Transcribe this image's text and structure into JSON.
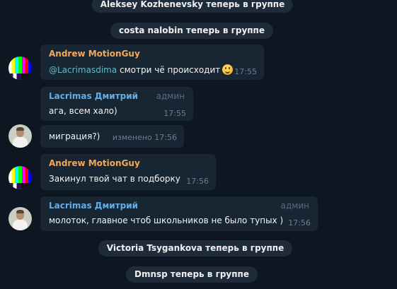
{
  "service_messages": {
    "aleksey": "Aleksey Kozhenevsky теперь в группе",
    "costa": "costa nalobin теперь в группе",
    "victoria": "Victoria Tsygankova теперь в группе",
    "dmnsp": "Dmnsp теперь в группе"
  },
  "messages": [
    {
      "sender": "Andrew MotionGuy",
      "mention": "@Lacrimasdima",
      "text": " смотри чё происходит",
      "emoji": "smiling-face",
      "time": "17:55"
    },
    {
      "sender": "Lacrimas Дмитрий",
      "role": "админ",
      "text": "ага, всем хало)",
      "time": "17:55"
    },
    {
      "text": "миграция?)",
      "time": "изменено 17:56"
    },
    {
      "sender": "Andrew MotionGuy",
      "text": "Закинул твой чат в подборку",
      "time": "17:56"
    },
    {
      "sender": "Lacrimas Дмитрий",
      "role": "админ",
      "text": "молоток, главное чтоб школьников не было тупых )",
      "time": "17:56"
    }
  ],
  "colors": {
    "background": "#0e1621",
    "bubble": "#182533",
    "service_pill": "#1e2c3a",
    "sender_andrew": "#f3a95c",
    "sender_lacrimas": "#63aee6",
    "mention": "#5fbdc9",
    "meta": "#6d7f8f"
  }
}
